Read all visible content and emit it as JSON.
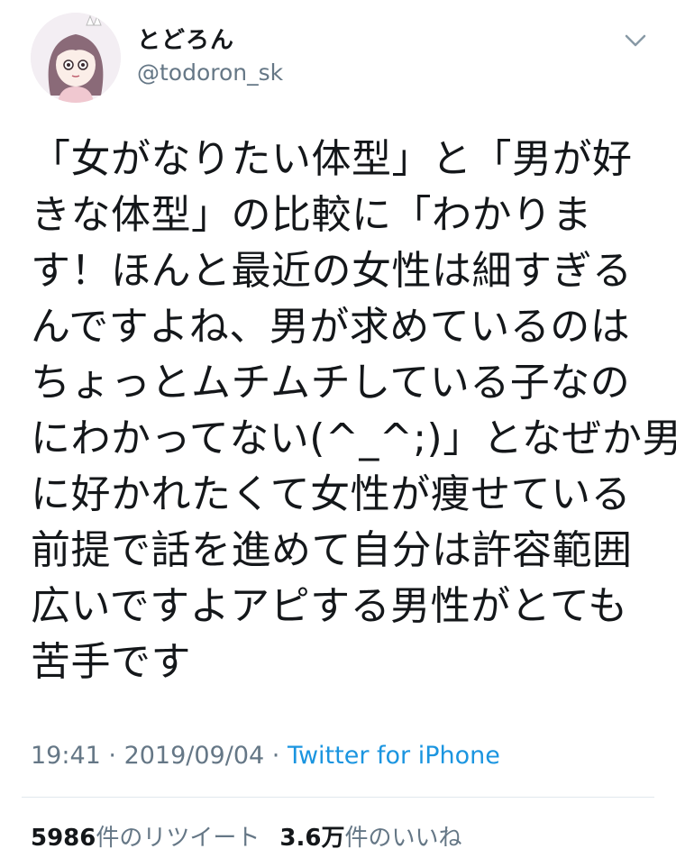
{
  "user": {
    "display_name": "とどろん",
    "handle": "@todoron_sk"
  },
  "tweet": {
    "lines": [
      "「女がなりたい体型」と「男が好",
      "きな体型」の比較に「わかりま",
      "す！ほんと最近の女性は細すぎる",
      "んですよね、男が求めているのは",
      "ちょっとムチムチしている子なの",
      "にわかってない(^_^;)」となぜか男",
      "に好かれたくて女性が痩せている",
      "前提で話を進めて自分は許容範囲",
      "広いですよアピする男性がとても",
      "苦手です"
    ]
  },
  "meta": {
    "time": "19:41",
    "separator": " · ",
    "date": "2019/09/04",
    "source": "Twitter for iPhone"
  },
  "stats": {
    "retweet_count": "5986",
    "retweet_label": "件のリツイート",
    "like_count": "3.6万",
    "like_label": "件のいいね"
  },
  "icons": {
    "menu": "chevron-down-icon",
    "avatar": "avatar-illustration"
  },
  "colors": {
    "text": "#14171a",
    "secondary": "#657786",
    "link": "#1b95e0",
    "divider": "#e1e8ed"
  }
}
